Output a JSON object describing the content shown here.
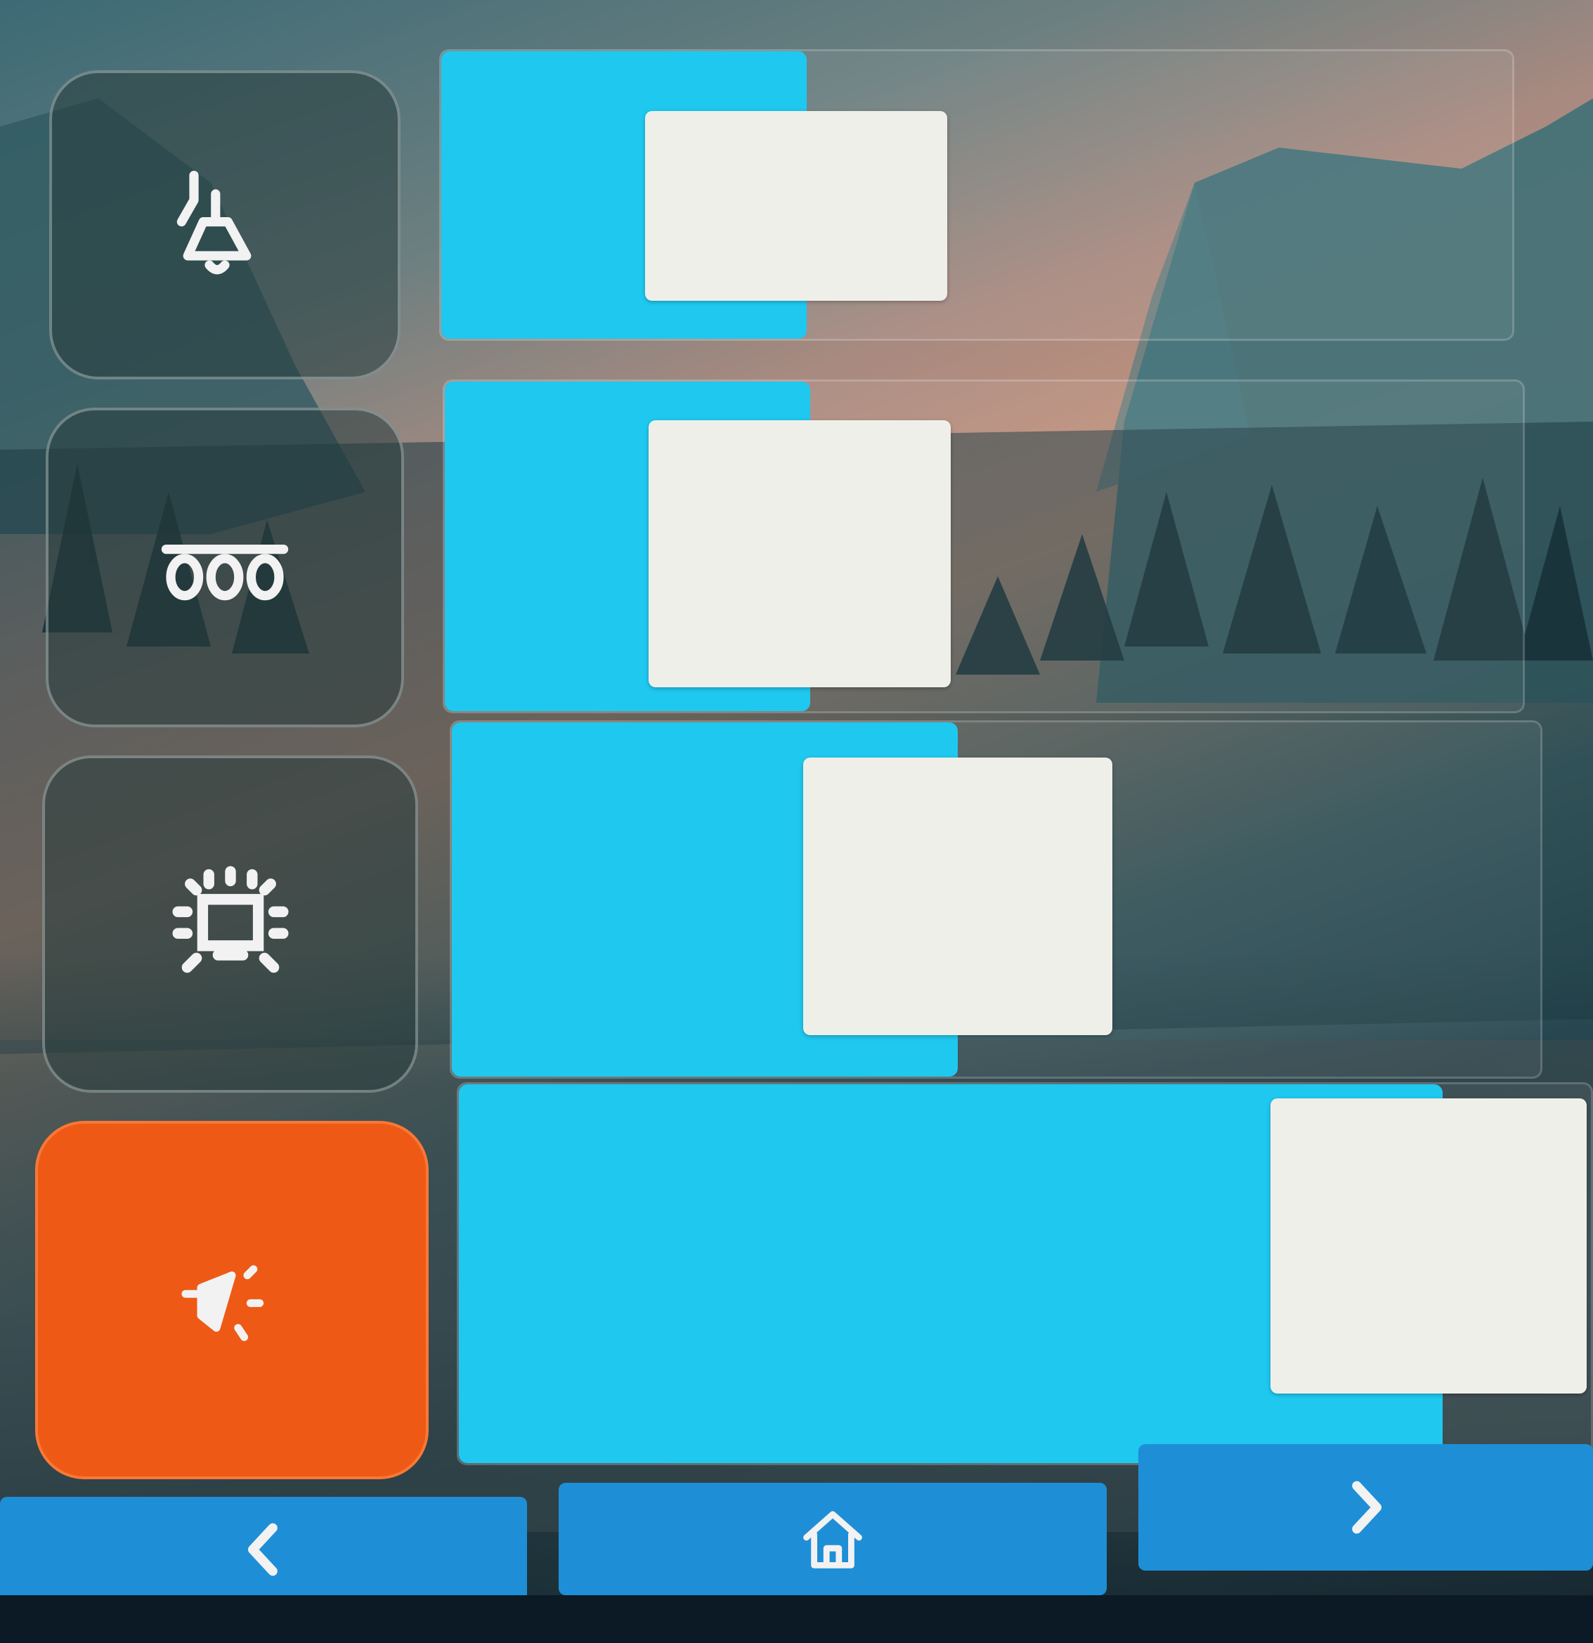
{
  "colors": {
    "accent": "#1fc8ef",
    "active_tile": "#ee5a15",
    "nav": "#1e8fd6",
    "knob": "#efefea"
  },
  "lights": [
    {
      "icon": "pendant-lamp-icon",
      "active": false,
      "level": 0.23
    },
    {
      "icon": "light-strip-icon",
      "active": false,
      "level": 0.22
    },
    {
      "icon": "ceiling-light-icon",
      "active": false,
      "level": 0.34
    },
    {
      "icon": "spotlight-icon",
      "active": true,
      "level": 0.88
    }
  ],
  "nav": {
    "back_icon": "chevron-left-icon",
    "home_icon": "home-icon",
    "forward_icon": "chevron-right-icon"
  }
}
